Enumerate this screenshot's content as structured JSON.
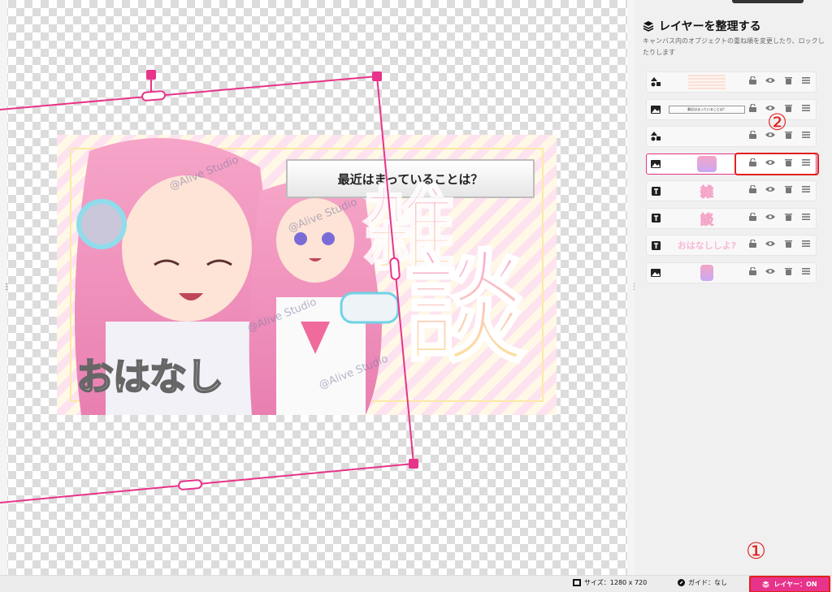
{
  "canvas": {
    "thumbnail": {
      "banner_text": "最近はまっていることは？",
      "kanji_1": "雑",
      "kanji_2": "談",
      "title_text": "おはなし",
      "watermark": "@Alive Studio"
    }
  },
  "layer_panel": {
    "title": "レイヤーを整理する",
    "description": "キャンバス内のオブジェクトの重ね順を変更したり、ロックしたりします",
    "layers": [
      {
        "type_icon": "shapes-icon",
        "thumb_kind": "stripe"
      },
      {
        "type_icon": "image-icon",
        "thumb_kind": "banner",
        "thumb_text": "最近はまっていることは？"
      },
      {
        "type_icon": "shapes-icon",
        "thumb_kind": "none"
      },
      {
        "type_icon": "image-icon",
        "thumb_kind": "character",
        "selected": true
      },
      {
        "type_icon": "text-icon",
        "thumb_kind": "glyph",
        "thumb_text": "雑"
      },
      {
        "type_icon": "text-icon",
        "thumb_kind": "glyph",
        "thumb_text": "談"
      },
      {
        "type_icon": "text-icon",
        "thumb_kind": "text",
        "thumb_text": "おはなししよ?"
      },
      {
        "type_icon": "image-icon",
        "thumb_kind": "character"
      }
    ],
    "action_icons": [
      "lock-icon",
      "eye-icon",
      "trash-icon",
      "menu-icon"
    ]
  },
  "annotations": {
    "marker_1": "①",
    "marker_2": "②"
  },
  "status_bar": {
    "size_label": "サイズ：1280 x 720",
    "guide_label": "ガイド：なし",
    "layer_button": "レイヤー：ON"
  },
  "colors": {
    "accent": "#e8338a",
    "annotation_red": "#e0201e"
  }
}
